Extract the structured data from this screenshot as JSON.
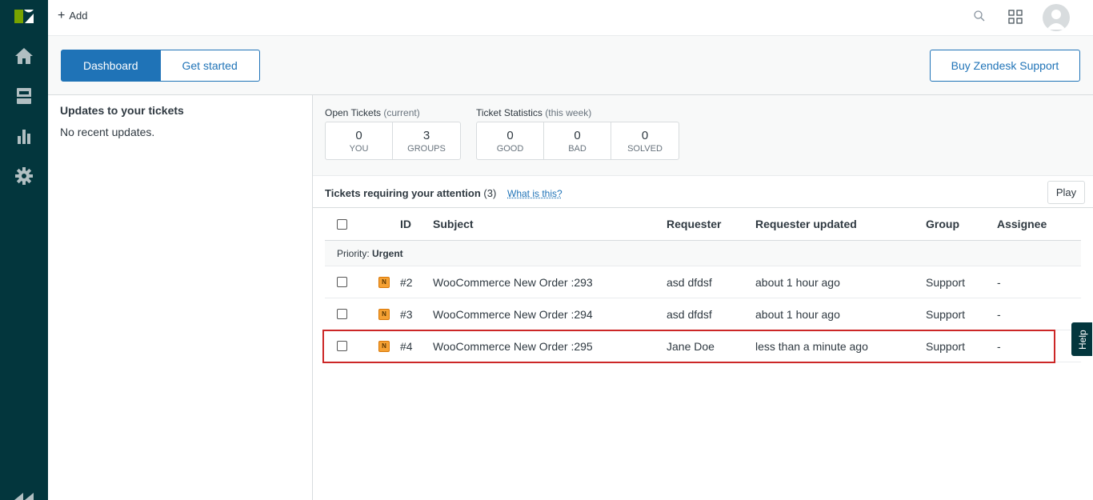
{
  "topbar": {
    "add_label": "Add"
  },
  "subbar": {
    "tab_dashboard": "Dashboard",
    "tab_get_started": "Get started",
    "buy_label": "Buy Zendesk Support"
  },
  "left_panel": {
    "title": "Updates to your tickets",
    "text": "No recent updates."
  },
  "open_tickets": {
    "label": "Open Tickets",
    "sub": "(current)",
    "boxes": [
      {
        "value": "0",
        "name": "YOU"
      },
      {
        "value": "3",
        "name": "GROUPS"
      }
    ]
  },
  "ticket_stats": {
    "label": "Ticket Statistics",
    "sub": "(this week)",
    "boxes": [
      {
        "value": "0",
        "name": "GOOD"
      },
      {
        "value": "0",
        "name": "BAD"
      },
      {
        "value": "0",
        "name": "SOLVED"
      }
    ]
  },
  "tickets": {
    "title": "Tickets requiring your attention",
    "count": "(3)",
    "what_link": "What is this?",
    "play_label": "Play",
    "columns": {
      "id": "ID",
      "subject": "Subject",
      "requester": "Requester",
      "requester_updated": "Requester updated",
      "group": "Group",
      "assignee": "Assignee"
    },
    "group_prefix": "Priority:",
    "group_value": "Urgent",
    "rows": [
      {
        "status": "N",
        "id": "#2",
        "subject": "WooCommerce New Order :293",
        "requester": "asd dfdsf",
        "updated": "about 1 hour ago",
        "group": "Support",
        "assignee": "-"
      },
      {
        "status": "N",
        "id": "#3",
        "subject": "WooCommerce New Order :294",
        "requester": "asd dfdsf",
        "updated": "about 1 hour ago",
        "group": "Support",
        "assignee": "-"
      },
      {
        "status": "N",
        "id": "#4",
        "subject": "WooCommerce New Order :295",
        "requester": "Jane Doe",
        "updated": "less than a minute ago",
        "group": "Support",
        "assignee": "-"
      }
    ]
  },
  "help_label": "Help",
  "colors": {
    "sidebar": "#03363d",
    "accent": "#1f73b7",
    "status_new": "#f5a133",
    "highlight": "#cc2727"
  }
}
